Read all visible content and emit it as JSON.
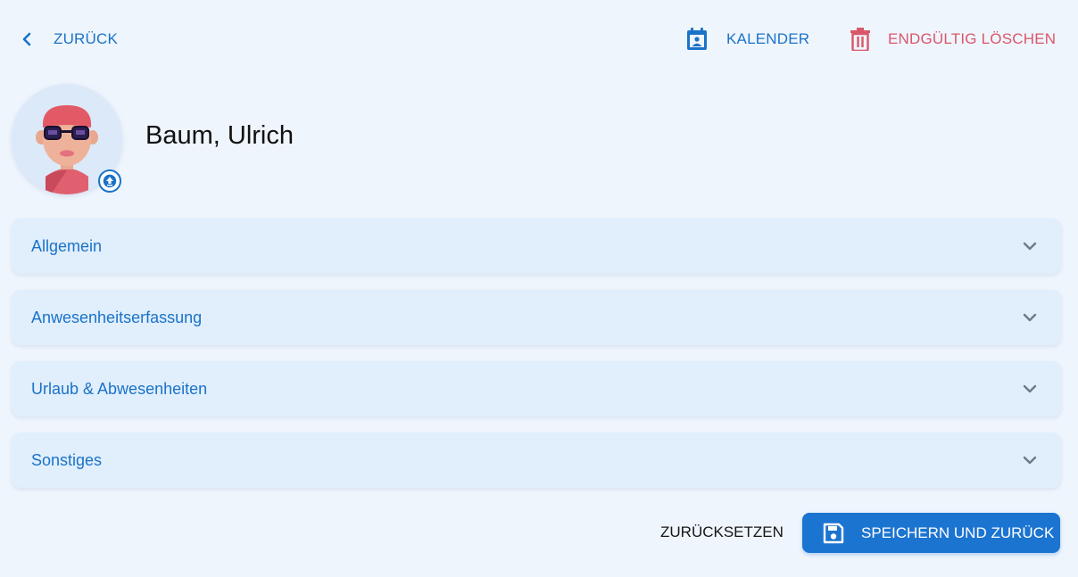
{
  "header": {
    "back_label": "Zurück",
    "calendar_label": "Kalender",
    "delete_label": "Endgültig löschen"
  },
  "profile": {
    "name": "Baum, Ulrich"
  },
  "sections": [
    {
      "label": "Allgemein"
    },
    {
      "label": "Anwesenheitserfassung"
    },
    {
      "label": "Urlaub & Abwesenheiten"
    },
    {
      "label": "Sonstiges"
    }
  ],
  "footer": {
    "reset_label": "Zurücksetzen",
    "save_label": "Speichern und zurück"
  },
  "colors": {
    "primary": "#1a73c8",
    "danger": "#d9576a",
    "background": "#eff5fd",
    "panel": "#e1eefc"
  },
  "icons": {
    "back": "chevron-left-icon",
    "calendar": "calendar-person-icon",
    "delete": "trash-icon",
    "upload": "upload-icon",
    "expand": "chevron-down-icon",
    "save": "floppy-disk-icon"
  }
}
